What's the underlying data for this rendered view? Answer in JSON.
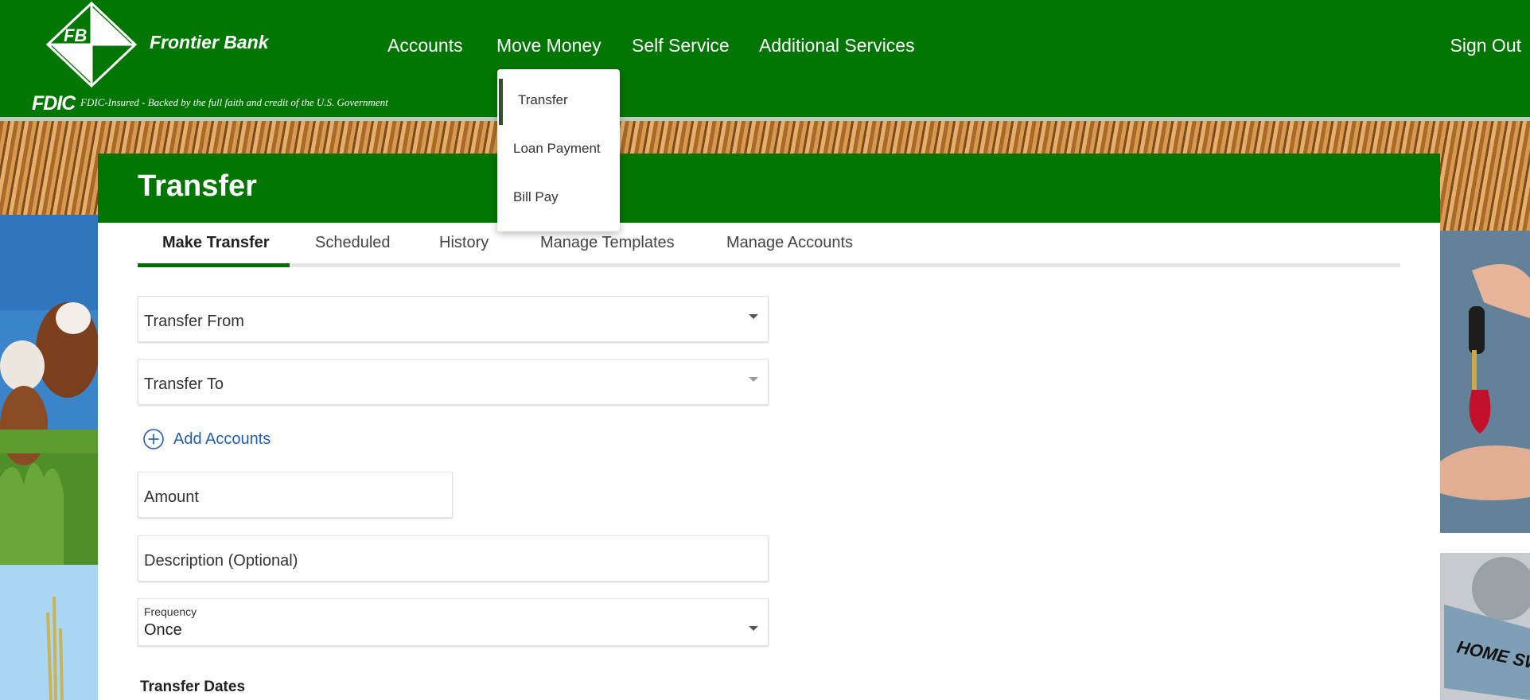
{
  "header": {
    "brand": "Frontier Bank",
    "logo_text": "FB",
    "fdic": "FDIC",
    "fdic_text": "FDIC-Insured - Backed by the full faith and credit of the U.S. Government",
    "nav": [
      "Accounts",
      "Move Money",
      "Self Service",
      "Additional Services"
    ],
    "sign_out": "Sign Out"
  },
  "menu": {
    "items": [
      "Transfer",
      "Loan Payment",
      "Bill Pay"
    ],
    "selected": "Transfer"
  },
  "page": {
    "title": "Transfer",
    "tabs": [
      "Make Transfer",
      "Scheduled",
      "History",
      "Manage Templates",
      "Manage Accounts"
    ],
    "active_tab": "Make Transfer"
  },
  "form": {
    "transfer_from": "Transfer From",
    "transfer_to": "Transfer To",
    "add_accounts": "Add Accounts",
    "amount": "Amount",
    "description": "Description (Optional)",
    "frequency_label": "Frequency",
    "frequency_value": "Once",
    "transfer_dates": "Transfer Dates"
  },
  "background": {
    "right_tag_text": "HOME SWEET HOME"
  },
  "colors": {
    "brand_green": "#027602",
    "link_blue": "#1e5fb5",
    "tab_ink": "#0a6a0a"
  }
}
